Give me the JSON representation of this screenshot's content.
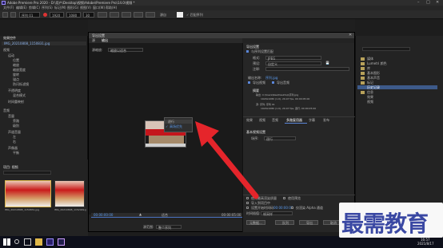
{
  "window": {
    "app_icon": "premiere-pr-icon",
    "title": "Adobe Premiere Pro 2020 - D:\\用户\\Desktop\\视频\\Adobe\\Premiere Pro\\14.0\\视频 *"
  },
  "menu": {
    "items": [
      "文件(F)",
      "编辑(E)",
      "剪辑(C)",
      "序列(S)",
      "标记(M)",
      "图形(G)",
      "视图(V)",
      "窗口(W)",
      "帮助(H)"
    ]
  },
  "toolbar": {
    "sequence_field": "序列 01",
    "width_value": "1920",
    "height_value": "1080",
    "fps_value": "30",
    "source_label": "源自",
    "option_label": "✓ 匹配序列"
  },
  "left_panel": {
    "tab": "效果控件",
    "clip_name": "IMG_20210808_1150831.jpg",
    "section_video": "视频",
    "properties": [
      "运动",
      "位置",
      "缩放",
      "缩放宽度",
      "旋转",
      "锚点",
      "防闪烁滤镜",
      "不透明度",
      "混合模式",
      "时间重映射"
    ],
    "section_audio": "音频",
    "audio_properties": [
      "音量",
      "旁路",
      "级别",
      "声道音量",
      "左",
      "右",
      "声像器",
      "平衡"
    ]
  },
  "left_bottom": {
    "tab": "项目: 视频",
    "thumbnails": [
      {
        "name": "IMG_20210808_1150831.jpg"
      },
      {
        "name": "IMG_20210808_1152049.jpg"
      }
    ]
  },
  "right_panel": {
    "items": [
      "媒体",
      "Lumetri 颜色",
      "库",
      "基本图形",
      "基本声音",
      "标记",
      "历史记录",
      "信息",
      "效果",
      "视频"
    ]
  },
  "dialog": {
    "title": "导出设置",
    "tabs": [
      "源",
      "输出"
    ],
    "source_scaling_label": "源缩放:",
    "source_scaling_value": "缩放以适合",
    "timecode_start": "00:00:00:00",
    "fit_label": "适合",
    "timecode_end": "00:00:05:00",
    "range_label": "源范围:",
    "range_value": "整个序列",
    "export_settings": {
      "header": "导出设置",
      "match_sequence_label": "与序列设置匹配",
      "format_label": "格式:",
      "format_value": "JPEG",
      "preset_label": "预设:",
      "preset_value": "自定义",
      "comment_label": "注释:",
      "output_name_label": "输出名称:",
      "output_name_value": "序列.jpg",
      "export_video_label": "导出视频",
      "export_audio_label": "导出音频",
      "summary_header": "摘要",
      "summary_output": "输出: C:\\Users\\Ree\\Desktop\\序列.jpg",
      "summary_output_detail": "1920x1080 (1.0), 29.97 fps, 00:00:05:00",
      "summary_source": "源: 序列, 序列 01",
      "summary_source_detail": "1920x1080 (1.0), 29.97 fps, 逐行, 00:00:05:00"
    },
    "settings_tabs": [
      "效果",
      "视频",
      "音频",
      "多路复用器",
      "字幕",
      "发布"
    ],
    "basic_video": {
      "header": "基本视频设置",
      "field_order_label": "场序:",
      "field_order_value": "逐行",
      "options": [
        "逐行",
        "高场优先"
      ]
    },
    "bottom_options": {
      "max_render_quality": "使用最高渲染质量",
      "use_previews": "使用预览",
      "import_into_project": "导入到项目中",
      "set_start_timecode": "设置开始时间码",
      "start_timecode_value": "00:00:00:00",
      "render_alpha": "仅渲染 Alpha 通道",
      "interpolation_label": "时间插值:",
      "interpolation_value": "帧采样",
      "metadata_button": "元数据...",
      "queue_button": "队列",
      "export_button": "导出",
      "cancel_button": "取消"
    }
  },
  "overlay": {
    "watermark_text": "最需教育",
    "arrow_color": "#e5252b"
  },
  "taskbar": {
    "time": "16:57",
    "date": "2021/8/17",
    "icons": [
      "windows-start-icon",
      "search-icon",
      "task-view-icon",
      "file-explorer-icon",
      "premiere-pr-icon",
      "ae-ae-icon"
    ]
  }
}
